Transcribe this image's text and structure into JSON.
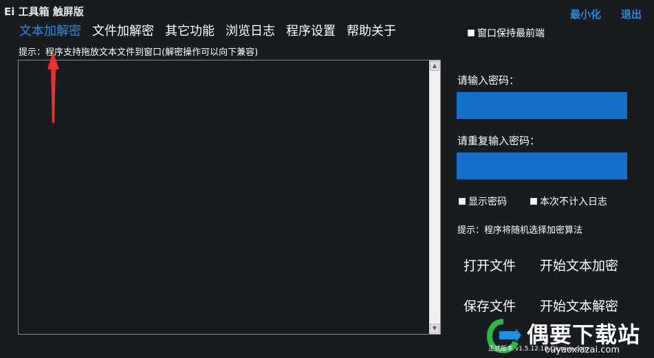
{
  "app": {
    "title": "Ei 工具箱 触屏版"
  },
  "window": {
    "minimize_label": "最小化",
    "exit_label": "退出"
  },
  "tabs": [
    {
      "label": "文本加解密",
      "active": true
    },
    {
      "label": "文件加解密",
      "active": false
    },
    {
      "label": "其它功能",
      "active": false
    },
    {
      "label": "浏览日志",
      "active": false
    },
    {
      "label": "程序设置",
      "active": false
    },
    {
      "label": "帮助关于",
      "active": false
    }
  ],
  "topmost": {
    "label": "窗口保持最前端",
    "checked": false
  },
  "editor": {
    "hint": "提示：程序支持拖放文本文件到窗口(解密操作可以向下兼容)",
    "content": ""
  },
  "password": {
    "label": "请输入密码：",
    "value": "",
    "repeat_label": "请重复输入密码：",
    "repeat_value": ""
  },
  "options": {
    "show_password": {
      "label": "显示密码",
      "checked": false
    },
    "no_log": {
      "label": "本次不计入日志",
      "checked": false
    }
  },
  "algo_hint": "提示：程序将随机选择加密算法",
  "actions": {
    "open_file": "打开文件",
    "start_encrypt": "开始文本加密",
    "save_file": "保存文件",
    "start_decrypt": "开始文本解密"
  },
  "watermark": {
    "brand": "偶要下载站",
    "url": "ouyaoxiazai.com",
    "note": "正式版本 v1.5.12.18 Qiunius.com"
  },
  "colors": {
    "background": "#181c21",
    "accent": "#2f8be0",
    "field": "#1570c8",
    "annotation_arrow": "#e8322d"
  }
}
